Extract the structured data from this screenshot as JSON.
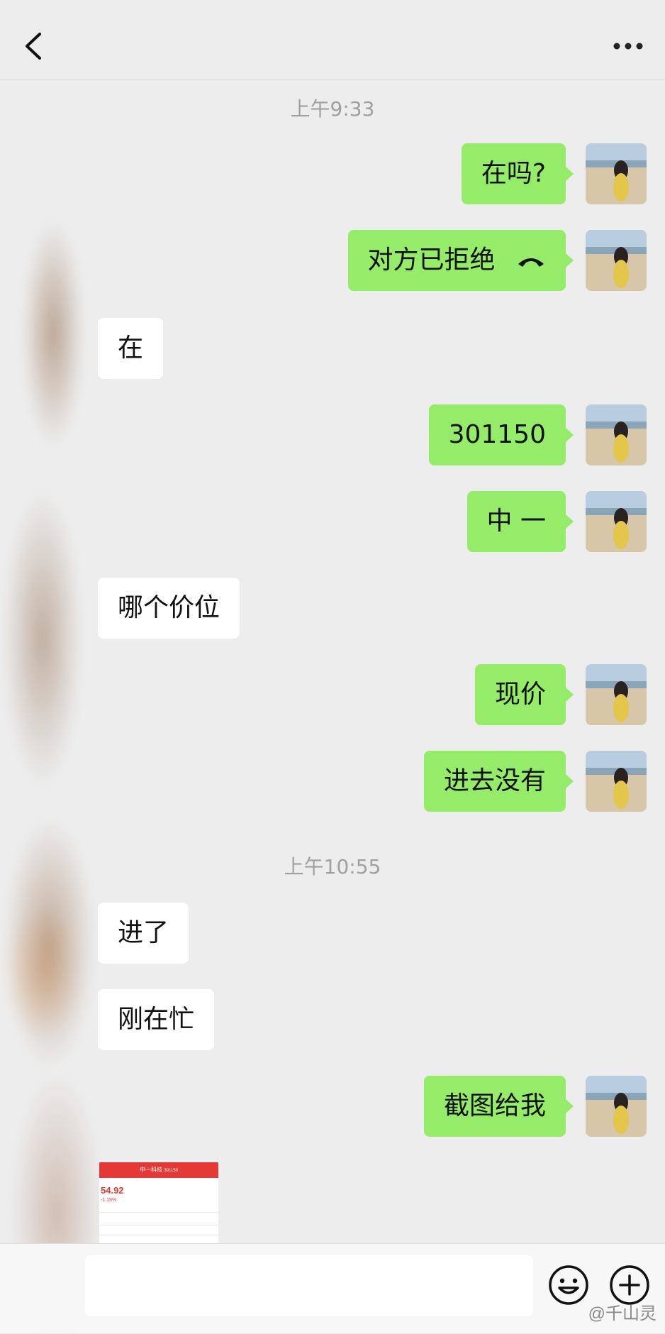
{
  "header": {
    "back_icon": "chevron-left-icon",
    "more_icon": "more-dots-icon"
  },
  "timestamps": [
    "上午9:33",
    "上午10:55"
  ],
  "messages": [
    {
      "dir": "out",
      "text": "在吗?"
    },
    {
      "dir": "out",
      "text": "对方已拒绝",
      "icon": "hangup-phone-icon"
    },
    {
      "dir": "in",
      "text": "在"
    },
    {
      "dir": "out",
      "text": "301150"
    },
    {
      "dir": "out",
      "text": "中 一"
    },
    {
      "dir": "in",
      "text": "哪个价位"
    },
    {
      "dir": "out",
      "text": "现价"
    },
    {
      "dir": "out",
      "text": "进去没有"
    },
    {
      "dir": "in",
      "text": "进了"
    },
    {
      "dir": "in",
      "text": "刚在忙"
    },
    {
      "dir": "out",
      "text": "截图给我"
    }
  ],
  "screenshot_thumb": {
    "title": "中一科技",
    "code": "301150",
    "price": "54.92",
    "change": "-1.19%"
  },
  "input_bar": {
    "emoji_icon": "emoji-icon",
    "plus_icon": "plus-circle-icon"
  },
  "watermark": "@千山灵"
}
